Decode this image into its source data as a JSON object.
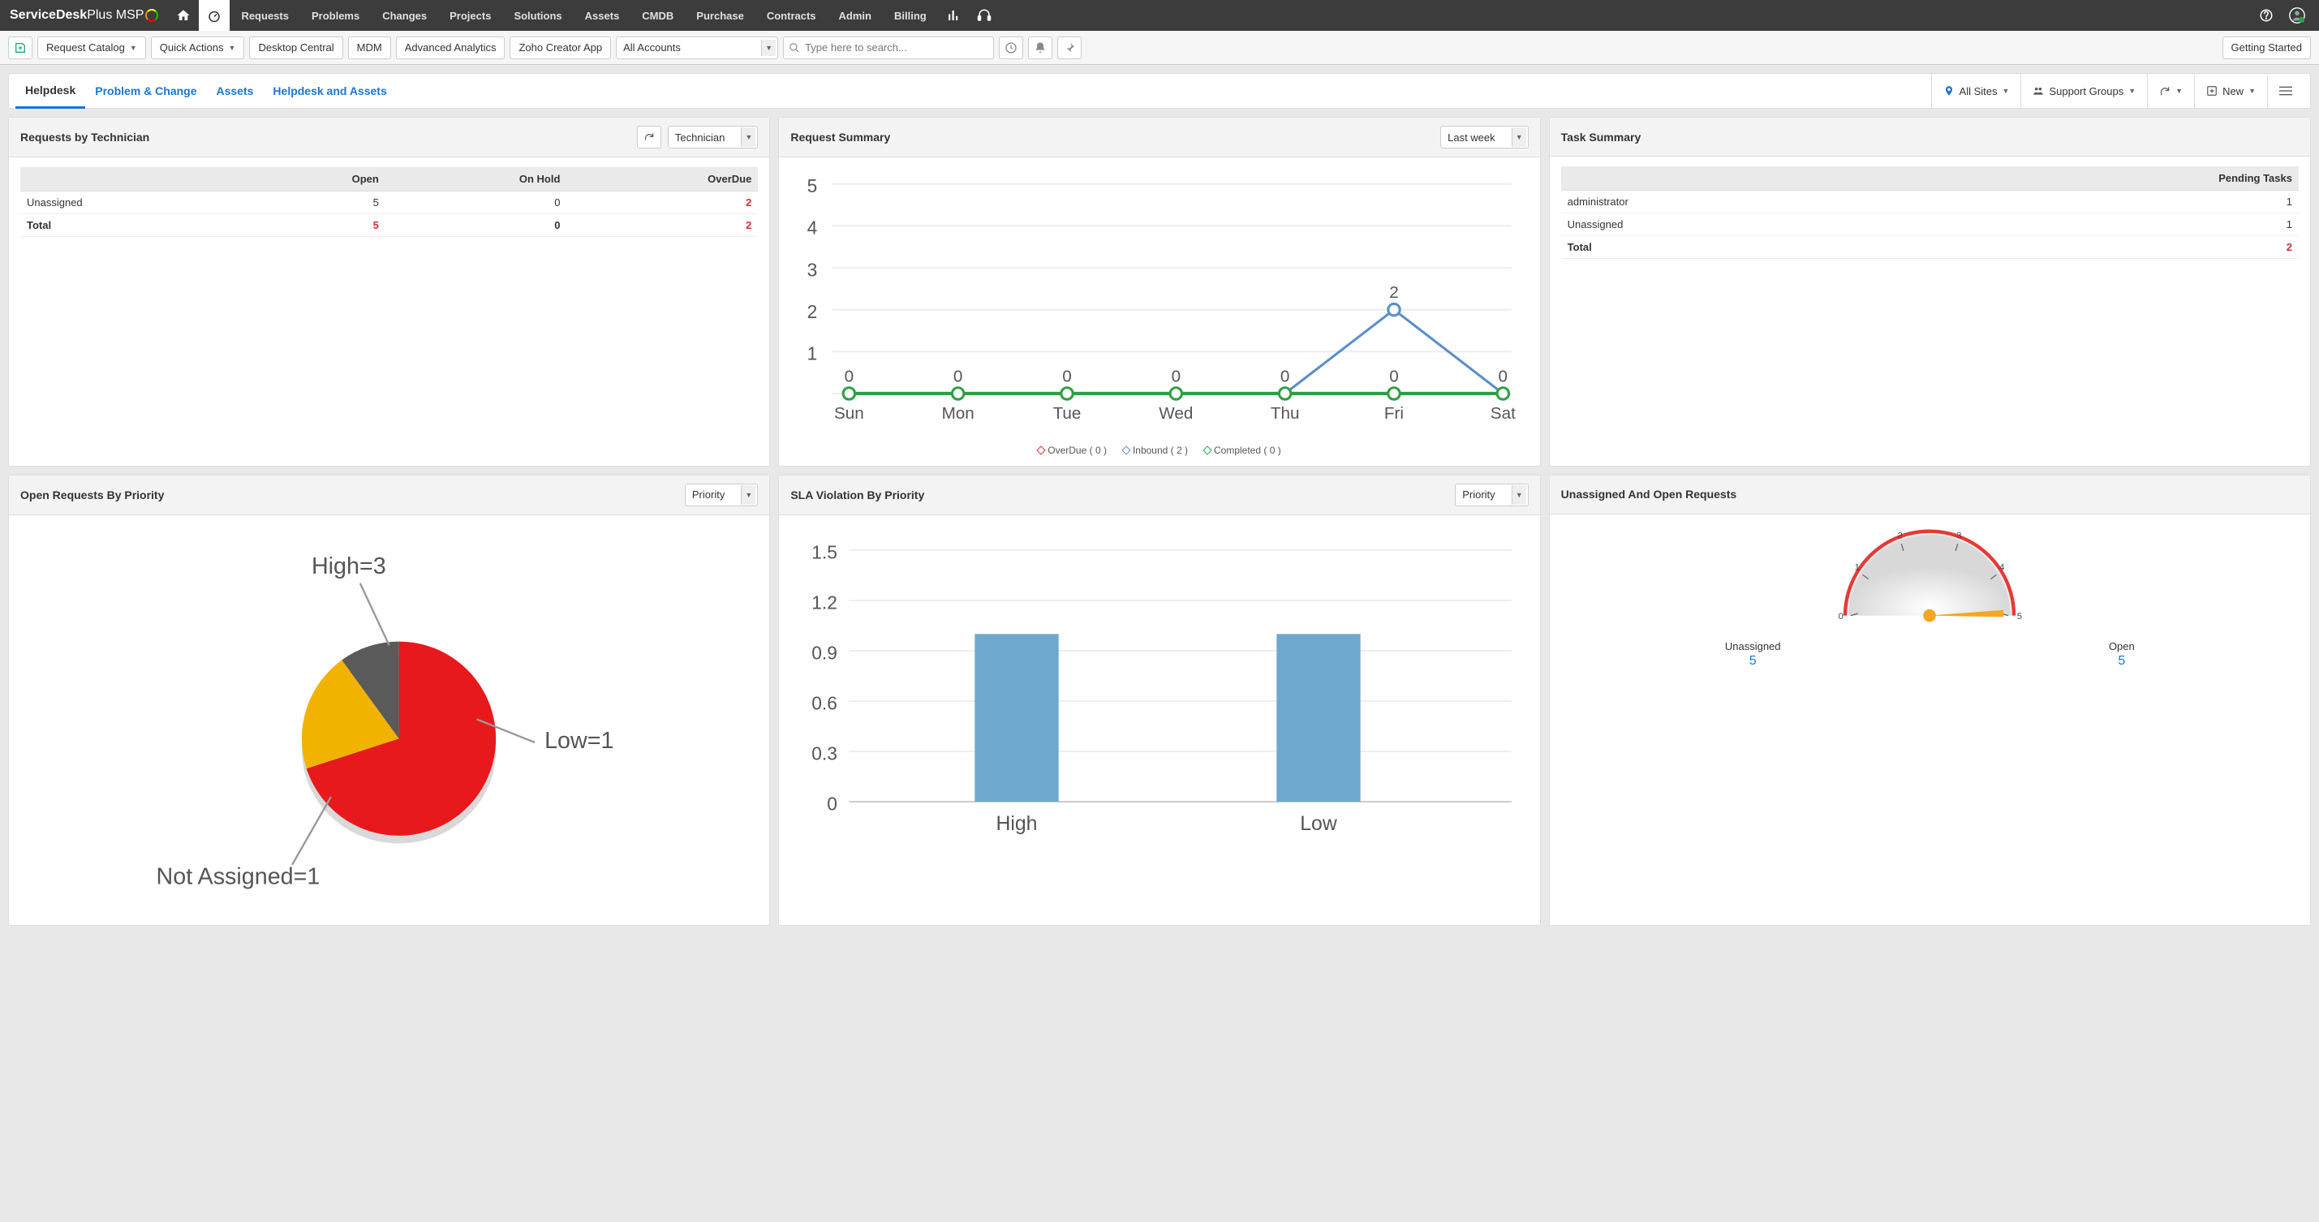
{
  "brand": {
    "part1": "ServiceDesk",
    "part2": " Plus MSP"
  },
  "topnav": [
    "Requests",
    "Problems",
    "Changes",
    "Projects",
    "Solutions",
    "Assets",
    "CMDB",
    "Purchase",
    "Contracts",
    "Admin",
    "Billing"
  ],
  "toolbar": {
    "request_catalog": "Request Catalog",
    "quick_actions": "Quick Actions",
    "desktop_central": "Desktop Central",
    "mdm": "MDM",
    "advanced_analytics": "Advanced Analytics",
    "zoho_creator": "Zoho Creator App",
    "accounts": "All Accounts",
    "search_placeholder": "Type here to search...",
    "getting_started": "Getting Started"
  },
  "tabs": [
    "Helpdesk",
    "Problem & Change",
    "Assets",
    "Helpdesk and Assets"
  ],
  "tabs_right": {
    "sites": "All Sites",
    "groups": "Support Groups",
    "new": "New"
  },
  "widgets": {
    "req_by_tech": {
      "title": "Requests by Technician",
      "select": "Technician",
      "cols": [
        "",
        "Open",
        "On Hold",
        "OverDue"
      ],
      "rows": [
        [
          "Unassigned",
          "5",
          "0",
          "2"
        ],
        [
          "Total",
          "5",
          "0",
          "2"
        ]
      ]
    },
    "req_summary": {
      "title": "Request Summary",
      "select": "Last week",
      "legend": {
        "overdue": "OverDue  ( 0 )",
        "inbound": "Inbound  ( 2 )",
        "completed": "Completed  ( 0 )"
      }
    },
    "task_summary": {
      "title": "Task Summary",
      "col": "Pending Tasks",
      "rows": [
        [
          "administrator",
          "1"
        ],
        [
          "Unassigned",
          "1"
        ],
        [
          "Total",
          "2"
        ]
      ]
    },
    "open_priority": {
      "title": "Open Requests By Priority",
      "select": "Priority"
    },
    "sla_priority": {
      "title": "SLA Violation By Priority",
      "select": "Priority"
    },
    "unassigned": {
      "title": "Unassigned And Open Requests",
      "l1": "Unassigned",
      "v1": "5",
      "l2": "Open",
      "v2": "5"
    }
  },
  "chart_data": [
    {
      "type": "line",
      "title": "Request Summary",
      "categories": [
        "Sun",
        "Mon",
        "Tue",
        "Wed",
        "Thu",
        "Fri",
        "Sat"
      ],
      "ylim": [
        0,
        5
      ],
      "series": [
        {
          "name": "OverDue",
          "values": [
            0,
            0,
            0,
            0,
            0,
            0,
            0
          ],
          "color": "#d32f2f"
        },
        {
          "name": "Inbound",
          "values": [
            0,
            0,
            0,
            0,
            0,
            2,
            0
          ],
          "color": "#5a8fc7"
        },
        {
          "name": "Completed",
          "values": [
            0,
            0,
            0,
            0,
            0,
            0,
            0
          ],
          "color": "#2ea043"
        }
      ]
    },
    {
      "type": "pie",
      "title": "Open Requests By Priority",
      "series": [
        {
          "name": "High",
          "value": 3,
          "color": "#e8191c"
        },
        {
          "name": "Low",
          "value": 1,
          "color": "#5a5a5a"
        },
        {
          "name": "Not Assigned",
          "value": 1,
          "color": "#f2b200"
        }
      ],
      "labels": [
        "High=3",
        "Low=1",
        "Not Assigned=1"
      ]
    },
    {
      "type": "bar",
      "title": "SLA Violation By Priority",
      "categories": [
        "High",
        "Low"
      ],
      "values": [
        1,
        1
      ],
      "ylim": [
        0,
        1.5
      ],
      "ticks": [
        0,
        0.3,
        0.6,
        0.9,
        1.2,
        1.5
      ],
      "color": "#6fa8cf"
    },
    {
      "type": "gauge",
      "title": "Unassigned And Open Requests",
      "min": 0,
      "max": 5,
      "value": 5,
      "ticks": [
        0,
        1,
        2,
        3,
        4,
        5
      ]
    }
  ]
}
